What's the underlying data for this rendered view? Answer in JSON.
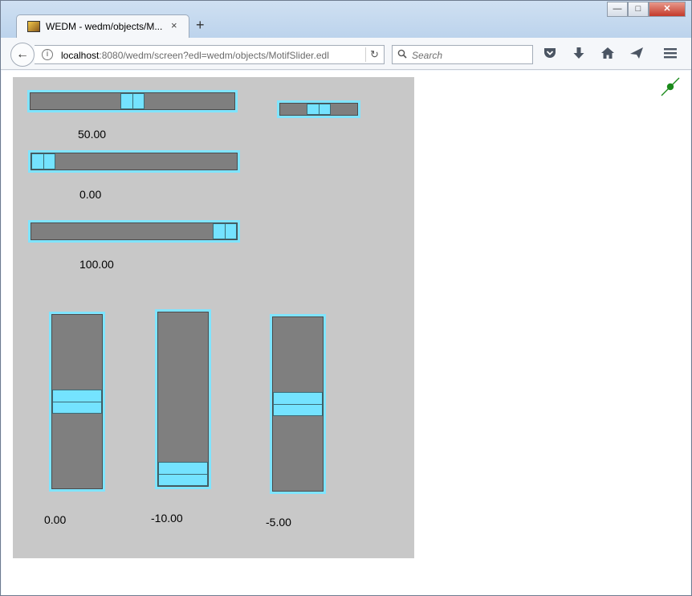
{
  "window": {
    "minimize": "—",
    "maximize": "□",
    "close": "✕"
  },
  "tab": {
    "title": "WEDM - wedm/objects/M...",
    "close": "×",
    "new_tab": "+"
  },
  "navbar": {
    "back": "←",
    "info": "i",
    "url_host": "localhost",
    "url_rest": ":8080/wedm/screen?edl=wedm/objects/MotifSlider.edl",
    "reload": "↻",
    "search_placeholder": "Search",
    "search_icon": "magnifier-icon"
  },
  "toolbar_icons": [
    "pocket-icon",
    "download-icon",
    "home-icon",
    "send-icon",
    "menu-icon"
  ],
  "colors": {
    "slider_border": "#7fe4ff",
    "slider_track": "#7f7f7f",
    "slider_thumb": "#74e3ff",
    "screen_bg": "#c8c8c8",
    "status_dot": "#1a8a1a"
  },
  "sliders": {
    "h1": {
      "value_label": "50.00",
      "level": 0.5
    },
    "h_small": {
      "level": 0.5
    },
    "h2": {
      "value_label": "0.00",
      "level": 0.0
    },
    "h3": {
      "value_label": "100.00",
      "level": 1.0
    },
    "v1": {
      "value_label": "0.00",
      "level": 0.5
    },
    "v2": {
      "value_label": "-10.00",
      "level": 0.0
    },
    "v3": {
      "value_label": "-5.00",
      "level": 0.5
    }
  }
}
